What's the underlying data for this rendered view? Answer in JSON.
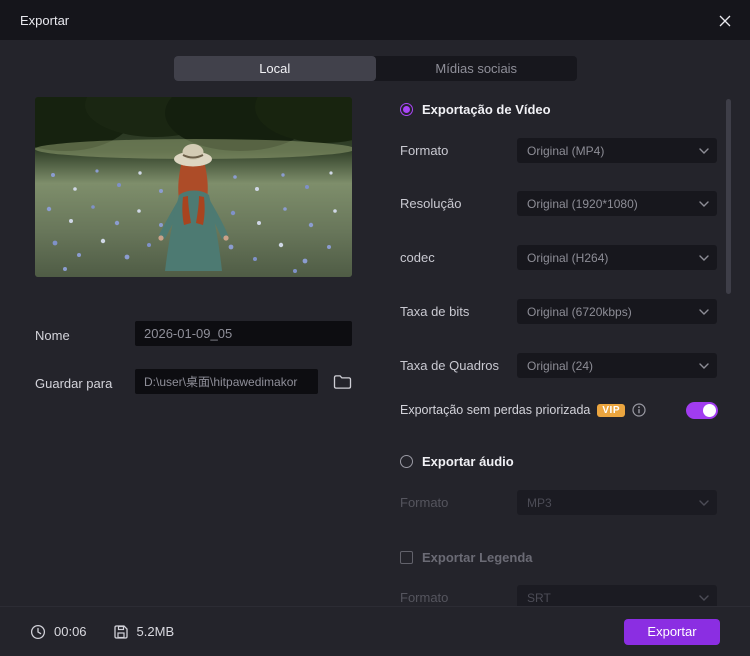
{
  "window": {
    "title": "Exportar"
  },
  "tabs": {
    "local": "Local",
    "social": "Mídias sociais"
  },
  "file": {
    "name_label": "Nome",
    "name_value": "2026-01-09_05",
    "path_label": "Guardar para",
    "path_value": "D:\\user\\桌面\\hitpawedimakor"
  },
  "video": {
    "title": "Exportação de Vídeo",
    "fields": [
      {
        "label": "Formato",
        "value": "Original (MP4)"
      },
      {
        "label": "Resolução",
        "value": "Original (1920*1080)"
      },
      {
        "label": "codec",
        "value": "Original (H264)"
      },
      {
        "label": "Taxa de bits",
        "value": "Original (6720kbps)"
      },
      {
        "label": "Taxa de Quadros",
        "value": "Original (24)"
      }
    ],
    "lossless_label": "Exportação sem perdas priorizada",
    "vip_badge": "VIP",
    "lossless_enabled": true
  },
  "audio": {
    "title": "Exportar áudio",
    "format_label": "Formato",
    "format_value": "MP3"
  },
  "subtitle": {
    "title": "Exportar Legenda",
    "format_label": "Formato",
    "format_value": "SRT"
  },
  "footer": {
    "duration": "00:06",
    "filesize": "5.2MB",
    "export_label": "Exportar"
  },
  "icons": {
    "close": "close-icon",
    "chevron": "chevron-down-icon",
    "folder": "folder-icon",
    "info": "info-icon",
    "clock": "clock-icon",
    "disk": "disk-icon"
  },
  "colors": {
    "accent": "#a13cf0",
    "vip": "#eba53f",
    "export_button": "#8b2ee2"
  }
}
